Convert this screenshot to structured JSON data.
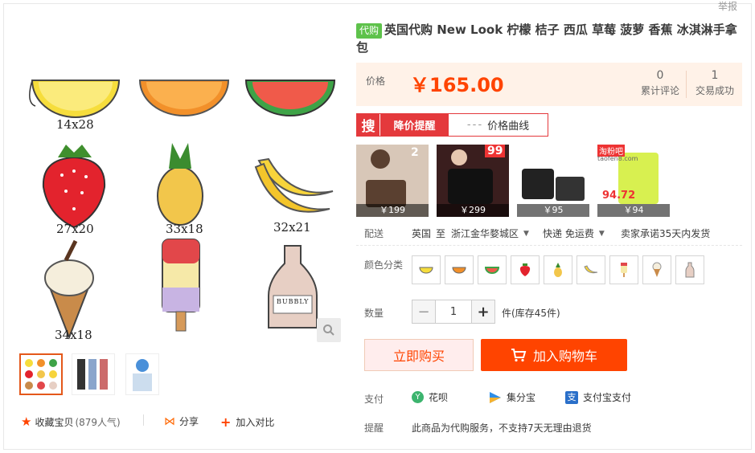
{
  "header": {
    "report": "举报"
  },
  "product": {
    "tag": "代购",
    "title": "英国代购 New Look 柠檬 桔子 西瓜 草莓 菠萝 香蕉 冰淇淋手拿包"
  },
  "price": {
    "label": "价格",
    "value": "￥165.00",
    "reviews_count": "0",
    "reviews_label": "累计评论",
    "sales_count": "1",
    "sales_label": "交易成功"
  },
  "price_alert": {
    "icon_text": "搜",
    "drop_label": "降价提醒",
    "curve_label": "价格曲线"
  },
  "ads": [
    {
      "price": "￥199",
      "badge": "2"
    },
    {
      "price": "￥299",
      "badge": "99"
    },
    {
      "price": "￥95"
    },
    {
      "price": "￥94",
      "badge": "淘粉吧",
      "sub": "taofen8.com",
      "tag": "94.72"
    }
  ],
  "image_labels": [
    "14x28",
    "27x20",
    "33x18",
    "32x21",
    "34x18"
  ],
  "image_text": "BUBBLY",
  "shipping": {
    "label": "配送",
    "from": "英国",
    "to_label": "至",
    "destination": "浙江金华婺城区",
    "method": "快递 免运费",
    "promise": "卖家承诺35天内发货"
  },
  "color": {
    "label": "颜色分类",
    "swatches": [
      "lemon",
      "orange",
      "watermelon",
      "strawberry",
      "pineapple",
      "banana",
      "icecream-pop",
      "icecream-cone",
      "milk-bottle"
    ]
  },
  "quantity": {
    "label": "数量",
    "value": "1",
    "unit": "件(库存45件)"
  },
  "buttons": {
    "buy_now": "立即购买",
    "add_cart": "加入购物车"
  },
  "payment": {
    "label": "支付",
    "huabei": "花呗",
    "jifenbao": "集分宝",
    "alipay": "支付宝支付"
  },
  "notice": {
    "label": "提醒",
    "text": "此商品为代购服务，不支持7天无理由退货"
  },
  "actions": {
    "favorite": "收藏宝贝",
    "popularity": "(879人气)",
    "share": "分享",
    "compare": "加入对比"
  },
  "colors": {
    "accent": "#ff4400",
    "tag_green": "#5ec24b",
    "alert_red": "#e4393c"
  }
}
